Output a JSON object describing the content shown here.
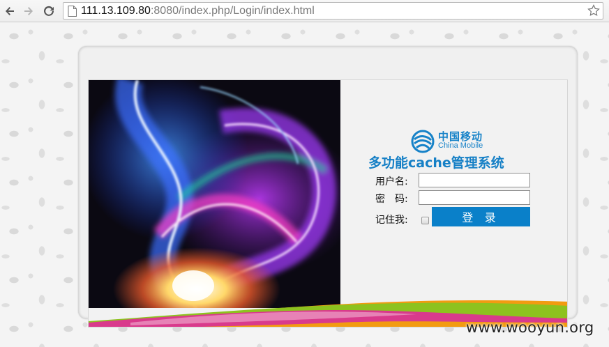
{
  "browser": {
    "url_host": "111.13.109.80",
    "url_rest": ":8080/index.php/Login/index.html"
  },
  "login": {
    "brand_cn": "中国移动",
    "brand_en": "China Mobile",
    "system_title": "多功能cache管理系统",
    "username_label": "用户名:",
    "username_value": "",
    "password_label": "密　码:",
    "password_value": "",
    "remember_label": "记住我:",
    "remember_checked": false,
    "submit_label": "登 录"
  },
  "watermark": "www.wooyun.org",
  "colors": {
    "brand_blue": "#1682c8",
    "button_blue": "#0a80c9",
    "swoosh_pink": "#d93a8c",
    "swoosh_green": "#8dc21f",
    "swoosh_orange": "#f29b11"
  },
  "icons": [
    "back-icon",
    "forward-icon",
    "reload-icon",
    "page-icon",
    "bookmark-star-icon",
    "china-mobile-logo-icon"
  ]
}
